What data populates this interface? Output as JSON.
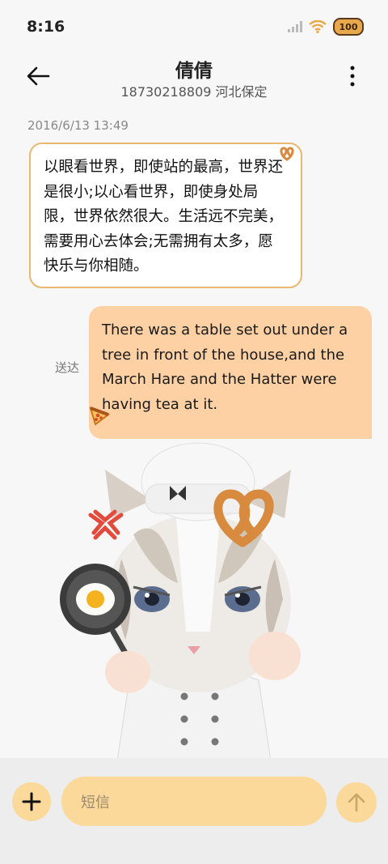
{
  "status_bar": {
    "time": "8:16",
    "battery": "100"
  },
  "header": {
    "contact_name": "倩倩",
    "contact_info": "18730218809 河北保定"
  },
  "conversation": {
    "timestamp": "2016/6/13 13:49",
    "incoming_message": "以眼看世界，即使站的最高，世界还是很小;以心看世界，即使身处局限，世界依然很大。生活远不完美，需要用心去体会;无需拥有太多，愿快乐与你相随。",
    "outgoing_message": "There was a table set out under a tree in front of the house,and the March Hare and the Hatter were having tea at it.",
    "outgoing_status": "送达"
  },
  "composer": {
    "placeholder": "短信"
  },
  "icons": {
    "back": "arrow-left-icon",
    "more": "more-vertical-icon",
    "add": "plus-icon",
    "send": "arrow-up-icon",
    "signal": "signal-icon",
    "wifi": "wifi-icon"
  },
  "colors": {
    "accent": "#fbd99b",
    "outgoing_bubble": "#fdd1a3",
    "incoming_border": "#e9b86e"
  }
}
